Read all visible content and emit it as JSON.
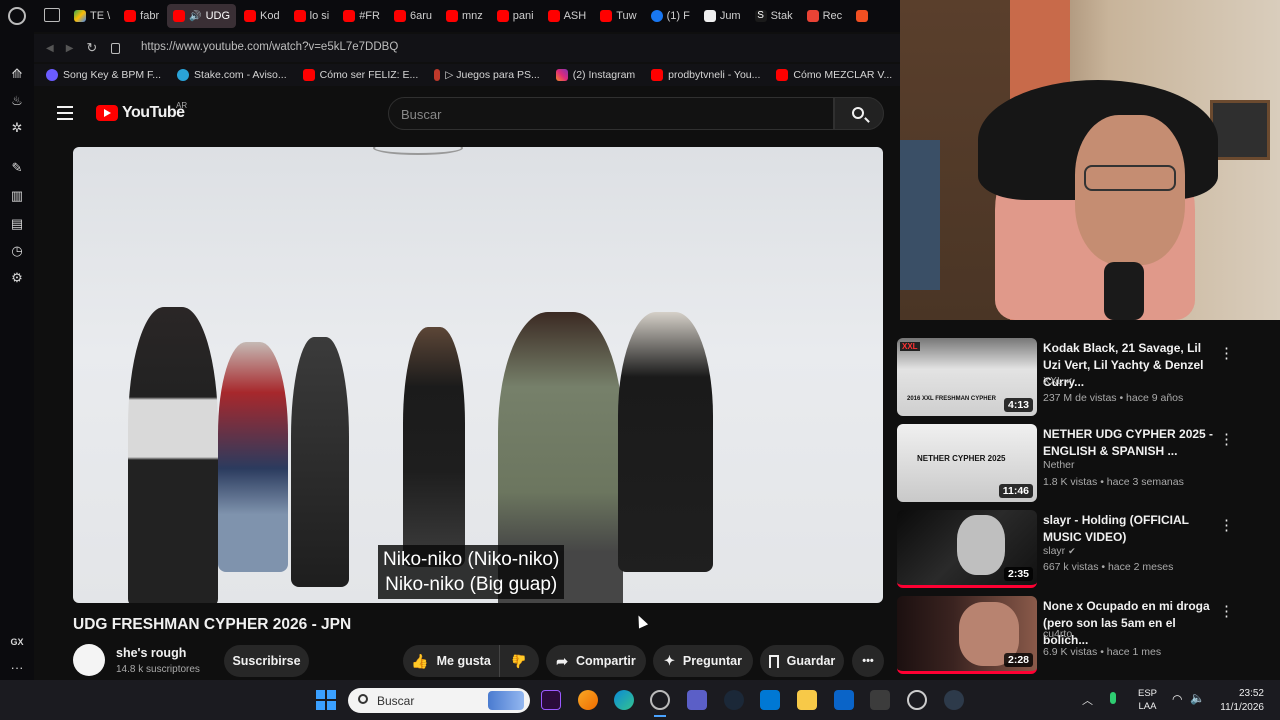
{
  "browser": {
    "tabs": [
      "TE \\",
      "fabr",
      "UDG",
      "Kod",
      "lo si",
      "#FR",
      "6aru",
      "mnz",
      "pani",
      "ASH",
      "Tuw",
      "(1) F",
      "Jum",
      "Stak",
      "Rec"
    ],
    "url": "https://www.youtube.com/watch?v=e5kL7e7DDBQ",
    "bookmarks": [
      "Song Key & BPM F...",
      "Stake.com - Aviso...",
      "Cómo ser FELIZ: E...",
      "▷ Juegos para PS...",
      "(2) Instagram",
      "prodbytvneli - You...",
      "Cómo MEZCLAR V..."
    ],
    "sidebar_gx": "GX",
    "sidebar_more": "···"
  },
  "youtube": {
    "logo_text": "YouTube",
    "region": "AR",
    "search_placeholder": "Buscar",
    "subtitle_line1": "Niko-niko (Niko-niko)",
    "subtitle_line2": "Niko-niko (Big guap)",
    "video_title": "UDG FRESHMAN CYPHER 2026 - JPN",
    "channel_name": "she's rough",
    "subscribers": "14.8 k suscriptores",
    "subscribe_label": "Suscribirse",
    "like_label": "Me gusta",
    "share_label": "Compartir",
    "ask_label": "Preguntar",
    "save_label": "Guardar",
    "more_label": "•••"
  },
  "recommendations": [
    {
      "title": "Kodak Black, 21 Savage, Lil Uzi Vert, Lil Yachty & Denzel Curry...",
      "channel": "XXL",
      "verified": true,
      "meta": "237 M de vistas • hace 9 años",
      "duration": "4:13",
      "thumb_text": "2016 XXL FRESHMAN CYPHER"
    },
    {
      "title": "NETHER UDG CYPHER 2025 - ENGLISH & SPANISH ...",
      "channel": "Nether",
      "verified": false,
      "meta": "1.8 K vistas • hace 3 semanas",
      "duration": "11:46",
      "thumb_text": "NETHER CYPHER 2025"
    },
    {
      "title": "slayr - Holding (OFFICIAL MUSIC VIDEO)",
      "channel": "slayr",
      "verified": true,
      "meta": "667 k vistas • hace 2 meses",
      "duration": "2:35",
      "thumb_text": ""
    },
    {
      "title": "None x Ocupado en mi droga (pero son las 5am en el bolich...",
      "channel": "cu4rto",
      "verified": false,
      "meta": "6.9 K vistas • hace 1 mes",
      "duration": "2:28",
      "thumb_text": ""
    }
  ],
  "taskbar": {
    "search_placeholder": "Buscar",
    "lang_top": "ESP",
    "lang_bottom": "LAA",
    "time": "23:52",
    "date": "11/1/2026"
  },
  "colors": {
    "yt_red": "#ff0000",
    "bg": "#0f0f0f",
    "pill": "#272727"
  }
}
